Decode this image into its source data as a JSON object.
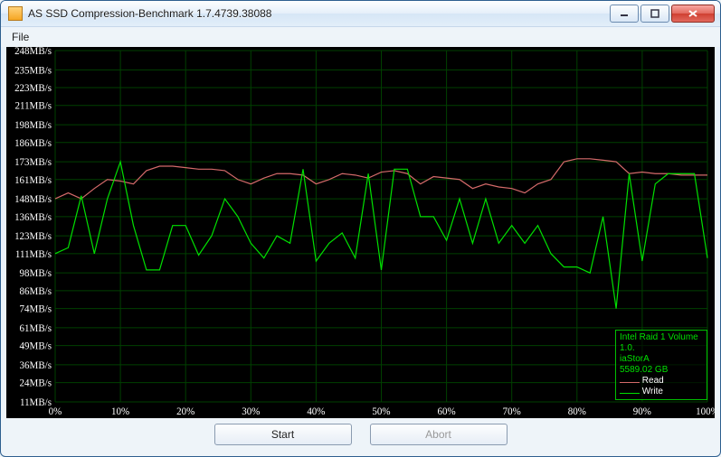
{
  "window": {
    "title": "AS SSD Compression-Benchmark 1.7.4739.38088"
  },
  "menubar": {
    "file": "File"
  },
  "buttons": {
    "start": "Start",
    "abort": "Abort"
  },
  "legend": {
    "line1": "Intel Raid 1 Volume",
    "line2": "1.0.",
    "line3": "iaStorA",
    "line4": "5589.02 GB",
    "read": "Read",
    "write": "Write"
  },
  "chart_data": {
    "type": "line",
    "title": "",
    "xlabel": "",
    "ylabel": "",
    "x_unit": "%",
    "y_unit": "MB/s",
    "xlim": [
      0,
      100
    ],
    "ylim": [
      11,
      248
    ],
    "y_ticks": [
      248,
      235,
      223,
      211,
      198,
      186,
      173,
      161,
      148,
      136,
      123,
      111,
      98,
      86,
      74,
      61,
      49,
      36,
      24,
      11
    ],
    "y_tick_labels": [
      "248MB/s",
      "235MB/s",
      "223MB/s",
      "211MB/s",
      "198MB/s",
      "186MB/s",
      "173MB/s",
      "161MB/s",
      "148MB/s",
      "136MB/s",
      "123MB/s",
      "111MB/s",
      "98MB/s",
      "86MB/s",
      "74MB/s",
      "61MB/s",
      "49MB/s",
      "36MB/s",
      "24MB/s",
      "11MB/s"
    ],
    "x_ticks": [
      0,
      10,
      20,
      30,
      40,
      50,
      60,
      70,
      80,
      90,
      100
    ],
    "x_tick_labels": [
      "0%",
      "10%",
      "20%",
      "30%",
      "40%",
      "50%",
      "60%",
      "70%",
      "80%",
      "90%",
      "100%"
    ],
    "series": [
      {
        "name": "Read",
        "color": "#d46a6a",
        "x": [
          0,
          2,
          4,
          6,
          8,
          10,
          12,
          14,
          16,
          18,
          20,
          22,
          24,
          26,
          28,
          30,
          32,
          34,
          36,
          38,
          40,
          42,
          44,
          46,
          48,
          50,
          52,
          54,
          56,
          58,
          60,
          62,
          64,
          66,
          68,
          70,
          72,
          74,
          76,
          78,
          80,
          82,
          84,
          86,
          88,
          90,
          92,
          94,
          96,
          98,
          100
        ],
        "y": [
          148,
          152,
          148,
          155,
          161,
          160,
          158,
          167,
          170,
          170,
          169,
          168,
          168,
          167,
          161,
          158,
          162,
          165,
          165,
          164,
          158,
          161,
          165,
          164,
          162,
          166,
          167,
          165,
          158,
          163,
          162,
          161,
          155,
          158,
          156,
          155,
          152,
          158,
          161,
          173,
          175,
          175,
          174,
          173,
          165,
          166,
          165,
          165,
          164,
          164,
          164
        ]
      },
      {
        "name": "Write",
        "color": "#00e000",
        "x": [
          0,
          2,
          4,
          6,
          8,
          10,
          12,
          14,
          16,
          18,
          20,
          22,
          24,
          26,
          28,
          30,
          32,
          34,
          36,
          38,
          40,
          42,
          44,
          46,
          48,
          50,
          52,
          54,
          56,
          58,
          60,
          62,
          64,
          66,
          68,
          70,
          72,
          74,
          76,
          78,
          80,
          82,
          84,
          86,
          88,
          90,
          92,
          94,
          96,
          98,
          100
        ],
        "y": [
          111,
          115,
          150,
          111,
          148,
          173,
          130,
          100,
          100,
          130,
          130,
          110,
          123,
          148,
          136,
          118,
          108,
          123,
          118,
          168,
          106,
          118,
          125,
          108,
          165,
          100,
          168,
          168,
          136,
          136,
          120,
          148,
          118,
          148,
          118,
          130,
          118,
          130,
          111,
          102,
          102,
          98,
          136,
          74,
          165,
          106,
          158,
          165,
          165,
          165,
          108
        ]
      }
    ]
  }
}
